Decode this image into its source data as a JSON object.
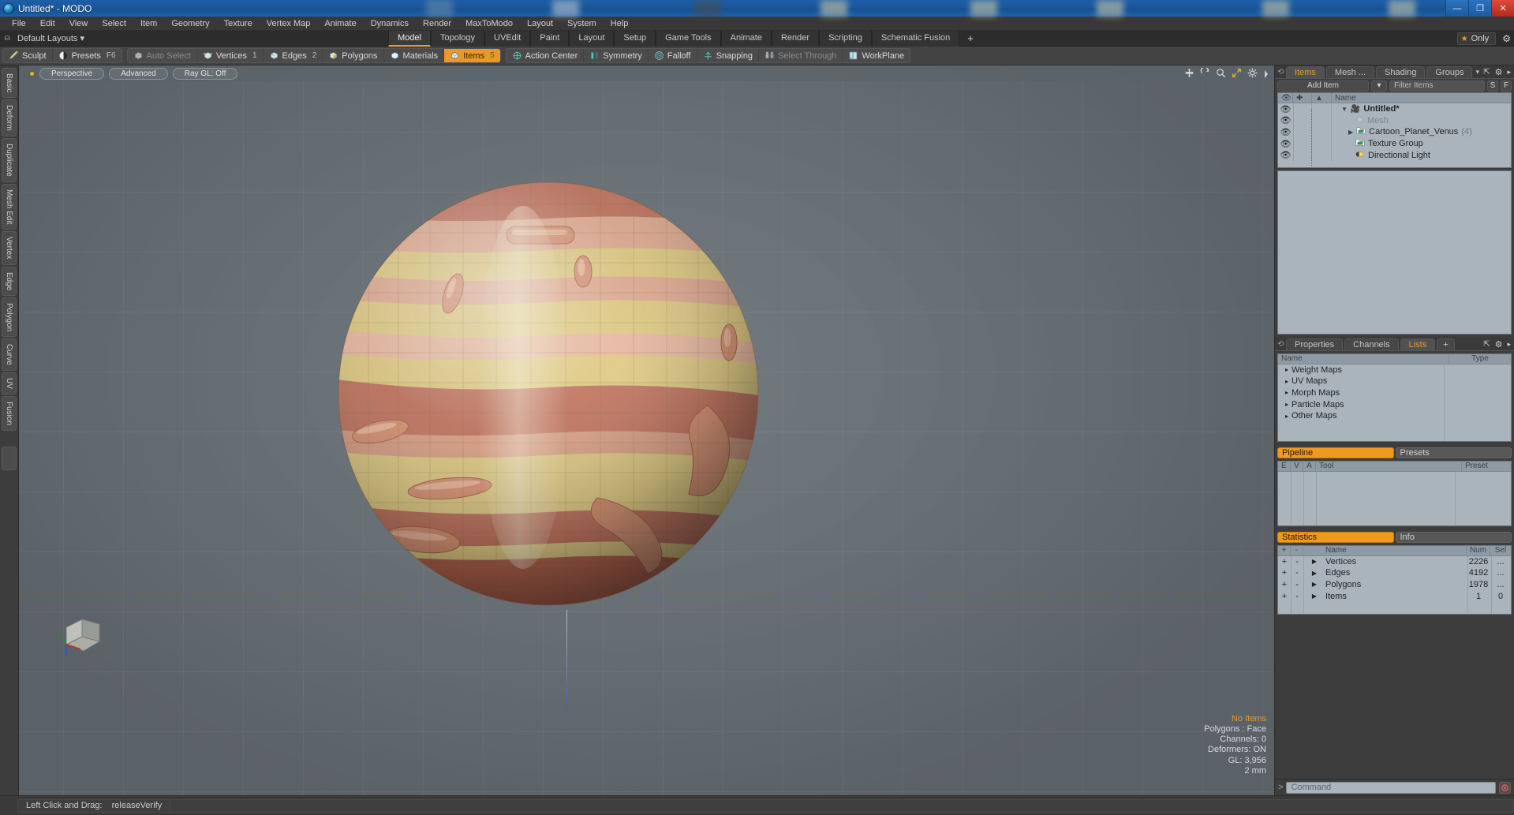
{
  "window": {
    "title": "Untitled* - MODO",
    "app_icon": "modo-sphere-icon",
    "buttons": {
      "minimize": "—",
      "maximize": "❐",
      "close": "✕"
    }
  },
  "menubar": {
    "items": [
      "File",
      "Edit",
      "View",
      "Select",
      "Item",
      "Geometry",
      "Texture",
      "Vertex Map",
      "Animate",
      "Dynamics",
      "Render",
      "MaxToModo",
      "Layout",
      "System",
      "Help"
    ]
  },
  "layoutbar": {
    "anchor_icon": "anchor-icon",
    "layout_selector": "Default Layouts",
    "layout_caret": "▾",
    "tabs": [
      "Model",
      "Topology",
      "UVEdit",
      "Paint",
      "Layout",
      "Setup",
      "Game Tools",
      "Animate",
      "Render",
      "Scripting",
      "Schematic Fusion"
    ],
    "active_tab": "Model",
    "add_tab": "+",
    "only_label": "Only",
    "only_star": "★",
    "gear_icon": "gear-icon"
  },
  "toolbar": {
    "group1": [
      {
        "label": "Sculpt",
        "icon": "sculpt-brush-icon",
        "state": "normal",
        "badge": ""
      },
      {
        "label": "Presets",
        "icon": "presets-sphere-icon",
        "state": "normal",
        "badge": "F6"
      }
    ],
    "group2": [
      {
        "label": "Auto Select",
        "icon": "cube-grey-icon",
        "state": "dim",
        "badge": ""
      },
      {
        "label": "Vertices",
        "icon": "cube-vertices-icon",
        "state": "normal",
        "badge": "1"
      },
      {
        "label": "Edges",
        "icon": "cube-edges-icon",
        "state": "normal",
        "badge": "2"
      },
      {
        "label": "Polygons",
        "icon": "cube-polygons-icon",
        "state": "normal",
        "badge": ""
      },
      {
        "label": "Materials",
        "icon": "cube-materials-icon",
        "state": "normal",
        "badge": ""
      },
      {
        "label": "Items",
        "icon": "cube-items-icon",
        "state": "active",
        "badge": "5"
      }
    ],
    "group3": [
      {
        "label": "Action Center",
        "icon": "action-center-icon",
        "state": "normal",
        "badge": ""
      },
      {
        "label": "Symmetry",
        "icon": "symmetry-icon",
        "state": "normal",
        "badge": ""
      },
      {
        "label": "Falloff",
        "icon": "falloff-icon",
        "state": "normal",
        "badge": ""
      },
      {
        "label": "Snapping",
        "icon": "snapping-icon",
        "state": "normal",
        "badge": ""
      },
      {
        "label": "Select Through",
        "icon": "select-through-icon",
        "state": "dim",
        "badge": ""
      },
      {
        "label": "WorkPlane",
        "icon": "workplane-icon",
        "state": "normal",
        "badge": ""
      }
    ]
  },
  "left_tabs": {
    "items": [
      "Basic",
      "Deform",
      "Duplicate",
      "Mesh Edit",
      "Vertex",
      "Edge",
      "Polygon",
      "Curve",
      "UV",
      "Fusion"
    ]
  },
  "viewport": {
    "pills": [
      "Perspective",
      "Advanced",
      "Ray GL: Off"
    ],
    "nav_icons": [
      "move-icon",
      "rotate-icon",
      "zoom-icon",
      "fit-icon",
      "gear-icon",
      "chevron-right-icon"
    ],
    "hud": {
      "selection": "No Items",
      "lines": [
        "Polygons : Face",
        "Channels: 0",
        "Deformers: ON",
        "GL: 3,956",
        "2 mm"
      ]
    },
    "model_name": "Cartoon Planet Venus sphere",
    "colors": {
      "background": "#6c757b",
      "band_cream": "#dfc97f",
      "band_salmon": "#d79a81",
      "band_rust": "#b8614a",
      "horizon_line": "#b05a45"
    }
  },
  "items_panel": {
    "tabs": [
      "Items",
      "Mesh ...",
      "Shading",
      "Groups"
    ],
    "active_tab": "Items",
    "tab_caret": "▾",
    "right_icons": [
      "expand-icon",
      "gear-icon",
      "chevron-right-icon"
    ],
    "add_item_label": "Add Item",
    "add_item_caret": "▾",
    "filter_placeholder": "Filter Items",
    "s_button": "S",
    "f_button": "F",
    "columns": [
      "Name"
    ],
    "header_icons": [
      "eye-icon",
      "lock-icon",
      "render-icon"
    ],
    "rows": [
      {
        "name": "Untitled*",
        "icon": "scene-icon",
        "count": "",
        "indent": 0,
        "bold": true,
        "dim": false,
        "twirl": "▼"
      },
      {
        "name": "Mesh",
        "icon": "mesh-cube-icon",
        "count": "",
        "indent": 1,
        "bold": false,
        "dim": true,
        "twirl": ""
      },
      {
        "name": "Cartoon_Planet_Venus",
        "icon": "mesh-folder-icon",
        "count": "(4)",
        "indent": 1,
        "bold": false,
        "dim": false,
        "twirl": "▶"
      },
      {
        "name": "Texture Group",
        "icon": "mesh-folder-icon",
        "count": "",
        "indent": 1,
        "bold": false,
        "dim": false,
        "twirl": ""
      },
      {
        "name": "Directional Light",
        "icon": "light-icon",
        "count": "",
        "indent": 1,
        "bold": false,
        "dim": false,
        "twirl": ""
      }
    ]
  },
  "lists_panel": {
    "tabs": [
      "Properties",
      "Channels",
      "Lists"
    ],
    "active_tab": "Lists",
    "add_tab": "+",
    "right_icons": [
      "expand-icon",
      "gear-icon",
      "chevron-right-icon"
    ],
    "columns": [
      "Name",
      "Type"
    ],
    "rows": [
      {
        "name": "Weight Maps",
        "type": ""
      },
      {
        "name": "UV Maps",
        "type": ""
      },
      {
        "name": "Morph Maps",
        "type": ""
      },
      {
        "name": "Particle Maps",
        "type": ""
      },
      {
        "name": "Other Maps",
        "type": ""
      }
    ]
  },
  "pipeline_panel": {
    "tabs": [
      "Pipeline",
      "Presets"
    ],
    "active_tab": "Pipeline",
    "columns": [
      "E",
      "V",
      "A",
      "Tool",
      "Preset"
    ],
    "rows": []
  },
  "statistics_panel": {
    "tabs": [
      "Statistics",
      "Info"
    ],
    "active_tab": "Statistics",
    "columns": [
      "+",
      "-",
      "Name",
      "Num",
      "Sel"
    ],
    "rows": [
      {
        "plus": "+",
        "minus": "-",
        "twirl": "▶",
        "name": "Vertices",
        "num": "2226",
        "sel": "..."
      },
      {
        "plus": "+",
        "minus": "-",
        "twirl": "▶",
        "name": "Edges",
        "num": "4192",
        "sel": "..."
      },
      {
        "plus": "+",
        "minus": "-",
        "twirl": "▶",
        "name": "Polygons",
        "num": "1978",
        "sel": "..."
      },
      {
        "plus": "+",
        "minus": "-",
        "twirl": "▶",
        "name": "Items",
        "num": "1",
        "sel": "0"
      }
    ]
  },
  "command_bar": {
    "prompt": ">",
    "placeholder": "Command",
    "record_icon": "record-icon"
  },
  "statusbar": {
    "action_label": "Left Click and Drag:",
    "action_value": "releaseVerify"
  }
}
